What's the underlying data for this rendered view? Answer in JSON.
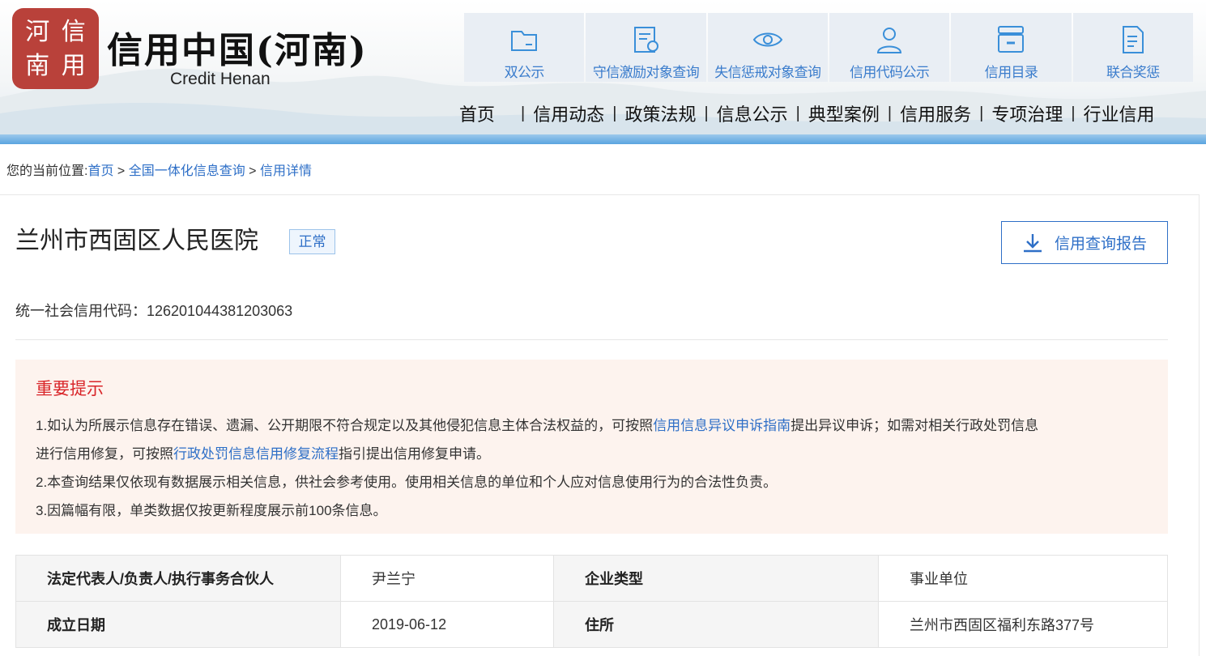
{
  "header": {
    "seal_chars": [
      "河",
      "信",
      "南",
      "用"
    ],
    "title": "信用中国(河南)",
    "subtitle": "Credit Henan"
  },
  "quicknav": [
    {
      "label": "双公示",
      "icon": "folder-icon"
    },
    {
      "label": "守信激励对象查询",
      "icon": "certificate-icon"
    },
    {
      "label": "失信惩戒对象查询",
      "icon": "eye-icon"
    },
    {
      "label": "信用代码公示",
      "icon": "user-icon"
    },
    {
      "label": "信用目录",
      "icon": "directory-icon"
    },
    {
      "label": "联合奖惩",
      "icon": "document-icon"
    }
  ],
  "mainnav": [
    "首页",
    "信用动态",
    "政策法规",
    "信息公示",
    "典型案例",
    "信用服务",
    "专项治理",
    "行业信用"
  ],
  "breadcrumb": {
    "prefix": "您的当前位置:",
    "items": [
      "首页",
      "全国一体化信息查询",
      "信用详情"
    ],
    "separator": " > "
  },
  "entity": {
    "name": "兰州市西固区人民医院",
    "status": "正常",
    "report_button": "信用查询报告",
    "code_label": "统一社会信用代码：",
    "code_value": "126201044381203063"
  },
  "notice": {
    "title": "重要提示",
    "line1_a": "1.如认为所展示信息存在错误、遗漏、公开期限不符合规定以及其他侵犯信息主体合法权益的，可按照",
    "line1_link": "信用信息异议申诉指南",
    "line1_b": "提出异议申诉；如需对相关行政处罚信息",
    "line2_a": "进行信用修复，可按照",
    "line2_link": "行政处罚信息信用修复流程",
    "line2_b": "指引提出信用修复申请。",
    "line3": "2.本查询结果仅依现有数据展示相关信息，供社会参考使用。使用相关信息的单位和个人应对信息使用行为的合法性负责。",
    "line4": "3.因篇幅有限，单类数据仅按更新程度展示前100条信息。"
  },
  "info_table": [
    {
      "k1": "法定代表人/负责人/执行事务合伙人",
      "v1": "尹兰宁",
      "k2": "企业类型",
      "v2": "事业单位"
    },
    {
      "k1": "成立日期",
      "v1": "2019-06-12",
      "k2": "住所",
      "v2": "兰州市西固区福利东路377号"
    }
  ],
  "colors": {
    "accent": "#2e6fc7",
    "danger": "#d9262a",
    "notice_bg": "#fdf3ee",
    "seal": "#b9413a"
  }
}
